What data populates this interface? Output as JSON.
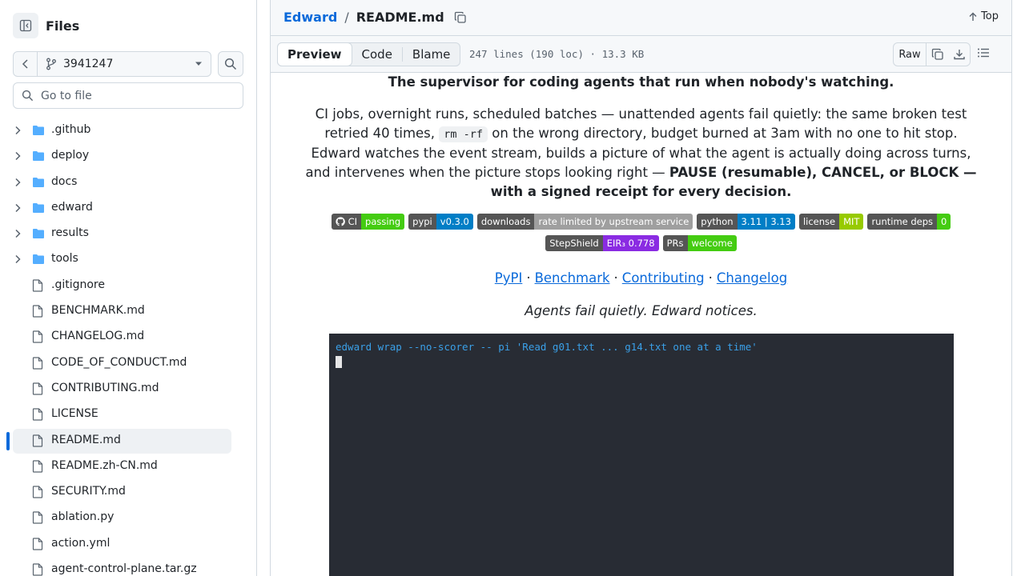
{
  "sidebar": {
    "title": "Files",
    "branch": "3941247",
    "goto_placeholder": "Go to file",
    "items": [
      {
        "label": ".github",
        "type": "folder"
      },
      {
        "label": "deploy",
        "type": "folder"
      },
      {
        "label": "docs",
        "type": "folder"
      },
      {
        "label": "edward",
        "type": "folder"
      },
      {
        "label": "results",
        "type": "folder"
      },
      {
        "label": "tools",
        "type": "folder"
      },
      {
        "label": ".gitignore",
        "type": "file"
      },
      {
        "label": "BENCHMARK.md",
        "type": "file"
      },
      {
        "label": "CHANGELOG.md",
        "type": "file"
      },
      {
        "label": "CODE_OF_CONDUCT.md",
        "type": "file"
      },
      {
        "label": "CONTRIBUTING.md",
        "type": "file"
      },
      {
        "label": "LICENSE",
        "type": "file"
      },
      {
        "label": "README.md",
        "type": "file",
        "selected": true
      },
      {
        "label": "README.zh-CN.md",
        "type": "file"
      },
      {
        "label": "SECURITY.md",
        "type": "file"
      },
      {
        "label": "ablation.py",
        "type": "file"
      },
      {
        "label": "action.yml",
        "type": "file"
      },
      {
        "label": "agent-control-plane.tar.gz",
        "type": "file"
      }
    ]
  },
  "header": {
    "repo": "Edward",
    "separator": "/",
    "file": "README.md",
    "top_label": "Top"
  },
  "toolbar": {
    "preview": "Preview",
    "code": "Code",
    "blame": "Blame",
    "file_info": "247 lines (190 loc) · 13.3 KB",
    "raw": "Raw"
  },
  "readme": {
    "tagline": "The supervisor for coding agents that run when nobody's watching.",
    "p1": "CI jobs, overnight runs, scheduled batches — unattended agents fail quietly: the same broken test retried 40 times,",
    "code": "rm -rf",
    "p2": "on the wrong directory, budget burned at 3am with no one to hit stop. Edward watches the event stream, builds a picture of what the agent is actually doing across turns, and intervenes when the picture stops looking right —",
    "p3_bold": "PAUSE (resumable), CANCEL, or BLOCK — with a signed receipt for every decision.",
    "badges_row1": [
      {
        "left": "CI",
        "right": "passing",
        "color": "#4c1",
        "gh": true
      },
      {
        "left": "pypi",
        "right": "v0.3.0",
        "color": "#007ec6"
      },
      {
        "left": "downloads",
        "right": "rate limited by upstream service",
        "color": "#9f9f9f"
      },
      {
        "left": "python",
        "right": "3.11 | 3.13",
        "color": "#007ec6"
      },
      {
        "left": "license",
        "right": "MIT",
        "color": "#97ca00"
      },
      {
        "left": "runtime deps",
        "right": "0",
        "color": "#4c1"
      }
    ],
    "badges_row2": [
      {
        "left": "StepShield",
        "right": "EIR₃ 0.778",
        "color": "#8a2be2"
      },
      {
        "left": "PRs",
        "right": "welcome",
        "color": "#4c1"
      }
    ],
    "links": [
      "PyPI",
      "Benchmark",
      "Contributing",
      "Changelog"
    ],
    "link_sep": "·",
    "motto": "Agents fail quietly. Edward notices.",
    "terminal_cmd": "edward wrap --no-scorer -- pi 'Read g01.txt ... g14.txt one at a time'"
  },
  "colors": {
    "accent": "#0969da",
    "folder": "#54aeff",
    "terminal_bg": "#282c34",
    "terminal_text": "#3aa0e8"
  }
}
